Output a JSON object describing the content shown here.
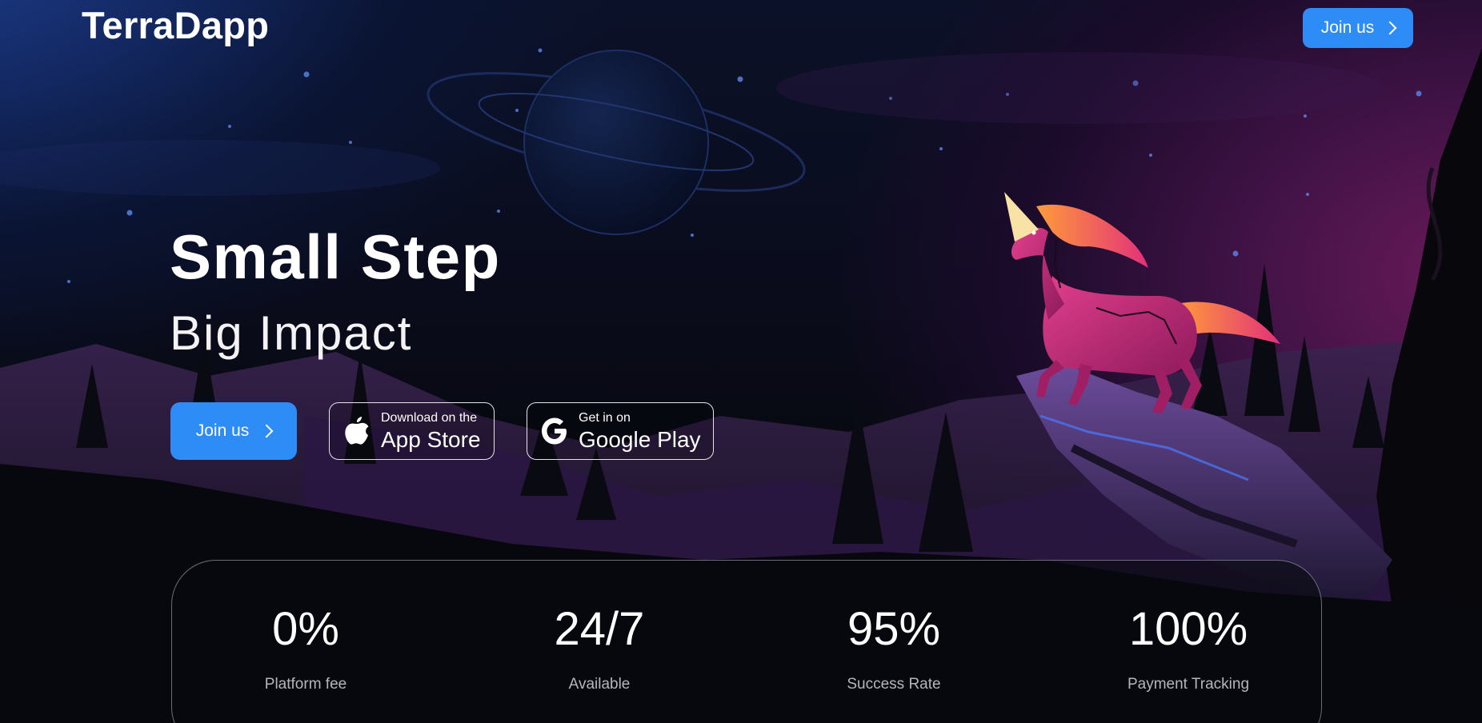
{
  "brand": {
    "logo_text": "TerraDapp"
  },
  "nav": {
    "join_label": "Join us"
  },
  "hero": {
    "title": "Small Step",
    "subtitle": "Big Impact",
    "join_label": "Join us"
  },
  "stores": {
    "apple": {
      "small": "Download on the",
      "big": "App Store",
      "icon": "apple-icon"
    },
    "google": {
      "small": "Get in on",
      "big": "Google Play",
      "icon": "google-icon"
    }
  },
  "stats": [
    {
      "value": "0%",
      "label": "Platform fee"
    },
    {
      "value": "24/7",
      "label": "Available"
    },
    {
      "value": "95%",
      "label": "Success Rate"
    },
    {
      "value": "100%",
      "label": "Payment Tracking"
    }
  ],
  "colors": {
    "accent": "#2d8cf5",
    "background": "#07080d",
    "magenta": "#c22a7a"
  }
}
